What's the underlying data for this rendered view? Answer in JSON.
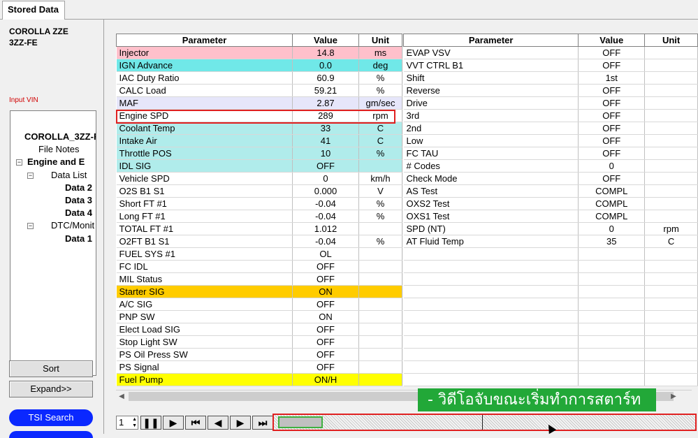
{
  "tab": {
    "label": "Stored Data"
  },
  "vehicle": {
    "line1": "COROLLA ZZE",
    "line2": "3ZZ-FE"
  },
  "vin_label": "Input VIN",
  "tree": [
    {
      "label": "COROLLA_3ZZ-F",
      "bold": true
    },
    {
      "label": "File Notes",
      "bold": false
    },
    {
      "label": "Engine and E",
      "bold": true,
      "expander": "⊟"
    },
    {
      "label": "Data List",
      "bold": false,
      "expander": "⊟"
    },
    {
      "label": "Data 2",
      "bold": true
    },
    {
      "label": "Data 3",
      "bold": true
    },
    {
      "label": "Data 4",
      "bold": true
    },
    {
      "label": "DTC/Monit",
      "bold": false,
      "expander": "⊟"
    },
    {
      "label": "Data 1",
      "bold": true
    }
  ],
  "buttons": {
    "sort": "Sort",
    "expand": "Expand>>",
    "tsi_search": "TSI Search"
  },
  "table_headers": {
    "parameter": "Parameter",
    "value": "Value",
    "unit": "Unit"
  },
  "left_table": [
    {
      "parameter": "Injector",
      "value": "14.8",
      "unit": "ms",
      "bg": "#ffc0cb"
    },
    {
      "parameter": "IGN Advance",
      "value": "0.0",
      "unit": "deg",
      "bg": "#70e8e8"
    },
    {
      "parameter": "IAC Duty Ratio",
      "value": "60.9",
      "unit": "%",
      "bg": ""
    },
    {
      "parameter": "CALC Load",
      "value": "59.21",
      "unit": "%",
      "bg": ""
    },
    {
      "parameter": "MAF",
      "value": "2.87",
      "unit": "gm/sec",
      "bg": "#e6e6fa"
    },
    {
      "parameter": "Engine SPD",
      "value": "289",
      "unit": "rpm",
      "bg": ""
    },
    {
      "parameter": "Coolant Temp",
      "value": "33",
      "unit": "C",
      "bg": "#b0eceb"
    },
    {
      "parameter": "Intake Air",
      "value": "41",
      "unit": "C",
      "bg": "#b0eceb"
    },
    {
      "parameter": "Throttle POS",
      "value": "10",
      "unit": "%",
      "bg": "#b0eceb"
    },
    {
      "parameter": "IDL SIG",
      "value": "OFF",
      "unit": "",
      "bg": "#b0eceb"
    },
    {
      "parameter": "Vehicle SPD",
      "value": "0",
      "unit": "km/h",
      "bg": ""
    },
    {
      "parameter": "O2S B1 S1",
      "value": "0.000",
      "unit": "V",
      "bg": ""
    },
    {
      "parameter": "Short FT #1",
      "value": "-0.04",
      "unit": "%",
      "bg": ""
    },
    {
      "parameter": "Long FT #1",
      "value": "-0.04",
      "unit": "%",
      "bg": ""
    },
    {
      "parameter": "TOTAL FT #1",
      "value": "1.012",
      "unit": "",
      "bg": ""
    },
    {
      "parameter": "O2FT B1 S1",
      "value": "-0.04",
      "unit": "%",
      "bg": ""
    },
    {
      "parameter": "FUEL SYS #1",
      "value": "OL",
      "unit": "",
      "bg": ""
    },
    {
      "parameter": "FC IDL",
      "value": "OFF",
      "unit": "",
      "bg": ""
    },
    {
      "parameter": "MIL Status",
      "value": "OFF",
      "unit": "",
      "bg": ""
    },
    {
      "parameter": "Starter SIG",
      "value": "ON",
      "unit": "",
      "bg": "#ffcc00"
    },
    {
      "parameter": "A/C SIG",
      "value": "OFF",
      "unit": "",
      "bg": ""
    },
    {
      "parameter": "PNP SW",
      "value": "ON",
      "unit": "",
      "bg": ""
    },
    {
      "parameter": "Elect Load SIG",
      "value": "OFF",
      "unit": "",
      "bg": ""
    },
    {
      "parameter": "Stop Light SW",
      "value": "OFF",
      "unit": "",
      "bg": ""
    },
    {
      "parameter": "PS Oil Press SW",
      "value": "OFF",
      "unit": "",
      "bg": ""
    },
    {
      "parameter": "PS Signal",
      "value": "OFF",
      "unit": "",
      "bg": ""
    },
    {
      "parameter": "Fuel Pump",
      "value": "ON/H",
      "unit": "",
      "bg": "#ffff00"
    }
  ],
  "right_table": [
    {
      "parameter": "EVAP VSV",
      "value": "OFF",
      "unit": ""
    },
    {
      "parameter": "VVT CTRL B1",
      "value": "OFF",
      "unit": ""
    },
    {
      "parameter": "Shift",
      "value": "1st",
      "unit": ""
    },
    {
      "parameter": "Reverse",
      "value": "OFF",
      "unit": ""
    },
    {
      "parameter": "Drive",
      "value": "OFF",
      "unit": ""
    },
    {
      "parameter": "3rd",
      "value": "OFF",
      "unit": ""
    },
    {
      "parameter": "2nd",
      "value": "OFF",
      "unit": ""
    },
    {
      "parameter": "Low",
      "value": "OFF",
      "unit": ""
    },
    {
      "parameter": "FC TAU",
      "value": "OFF",
      "unit": ""
    },
    {
      "parameter": "# Codes",
      "value": "0",
      "unit": ""
    },
    {
      "parameter": "Check Mode",
      "value": "OFF",
      "unit": ""
    },
    {
      "parameter": "AS Test",
      "value": "COMPL",
      "unit": ""
    },
    {
      "parameter": "OXS2 Test",
      "value": "COMPL",
      "unit": ""
    },
    {
      "parameter": "OXS1 Test",
      "value": "COMPL",
      "unit": ""
    },
    {
      "parameter": "SPD (NT)",
      "value": "0",
      "unit": "rpm"
    },
    {
      "parameter": "AT Fluid Temp",
      "value": "35",
      "unit": "C"
    },
    {
      "parameter": "",
      "value": "",
      "unit": ""
    },
    {
      "parameter": "",
      "value": "",
      "unit": ""
    },
    {
      "parameter": "",
      "value": "",
      "unit": ""
    },
    {
      "parameter": "",
      "value": "",
      "unit": ""
    },
    {
      "parameter": "",
      "value": "",
      "unit": ""
    },
    {
      "parameter": "",
      "value": "",
      "unit": ""
    },
    {
      "parameter": "",
      "value": "",
      "unit": ""
    },
    {
      "parameter": "",
      "value": "",
      "unit": ""
    },
    {
      "parameter": "",
      "value": "",
      "unit": ""
    },
    {
      "parameter": "",
      "value": "",
      "unit": ""
    },
    {
      "parameter": "",
      "value": "",
      "unit": ""
    }
  ],
  "playback": {
    "frame": "1",
    "controls": [
      {
        "name": "pause-icon",
        "glyph": "❚❚"
      },
      {
        "name": "play-icon",
        "glyph": "▶"
      },
      {
        "name": "skip-start-icon",
        "glyph": "⏮"
      },
      {
        "name": "step-back-icon",
        "glyph": "◀"
      },
      {
        "name": "step-forward-icon",
        "glyph": "▶"
      },
      {
        "name": "skip-end-icon",
        "glyph": "⏭"
      }
    ]
  },
  "overlay_caption": "- วิดีโอจับขณะเริ่มทำการสตาร์ท",
  "colors": {
    "highlight_red": "#e02020",
    "caption_green": "#22a838",
    "tsi_blue": "#0a28ff"
  }
}
